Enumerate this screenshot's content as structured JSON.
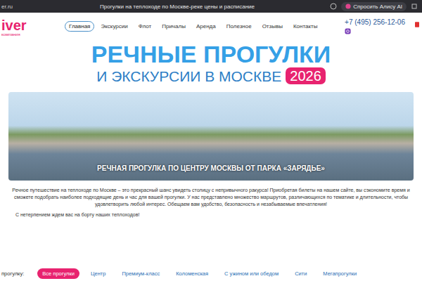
{
  "browser": {
    "address": "er.ru",
    "tab_title": "Прогулки на теплоходе по Москве-реке цены и расписание",
    "alice_button": "Спросить Алису AI"
  },
  "logo": {
    "name": "iver",
    "subtitle": "компания"
  },
  "nav": [
    {
      "label": "Главная",
      "selected": true
    },
    {
      "label": "Экскурсии",
      "selected": false
    },
    {
      "label": "Флот",
      "selected": false
    },
    {
      "label": "Причалы",
      "selected": false
    },
    {
      "label": "Аренда",
      "selected": false
    },
    {
      "label": "Полезное",
      "selected": false
    },
    {
      "label": "Отзывы",
      "selected": false
    },
    {
      "label": "Контакты",
      "selected": false
    }
  ],
  "contacts": {
    "phone": "+7 (495) 256-12-06"
  },
  "hero": {
    "title_line1": "РЕЧНЫЕ ПРОГУЛКИ",
    "title_line2": "И ЭКСКУРСИИ В МОСКВЕ",
    "year": "2026"
  },
  "banner": {
    "caption": "РЕЧНАЯ ПРОГУЛКА ПО ЦЕНТРУ МОСКВЫ ОТ ПАРКА «ЗАРЯДЬЕ»"
  },
  "intro": {
    "paragraph": "Речное путешествие на теплоходе по Москве – это прекрасный шанс увидеть столицу с непривычного ракурса! Приобретая билеты на нашем сайте, вы сэкономите время и сможете подобрать наиболее подходящие день и час для вашей прогулки. У нас представлено множество маршрутов, различающихся по тематике и длительности, чтобы удовлетворить любой интерес. Обещаем вам удобство, безопасность и незабываемые впечатления!",
    "greeting": "С нетерпением ждем вас на борту наших теплоходов!"
  },
  "filters": {
    "label": "прогулку:",
    "chips": [
      {
        "label": "Все прогулки",
        "selected": true
      },
      {
        "label": "Центр",
        "selected": false
      },
      {
        "label": "Премиум-класс",
        "selected": false
      },
      {
        "label": "Коломенская",
        "selected": false
      },
      {
        "label": "С ужином или обедом",
        "selected": false
      },
      {
        "label": "Сити",
        "selected": false
      },
      {
        "label": "Мегапрогулки",
        "selected": false
      }
    ]
  }
}
